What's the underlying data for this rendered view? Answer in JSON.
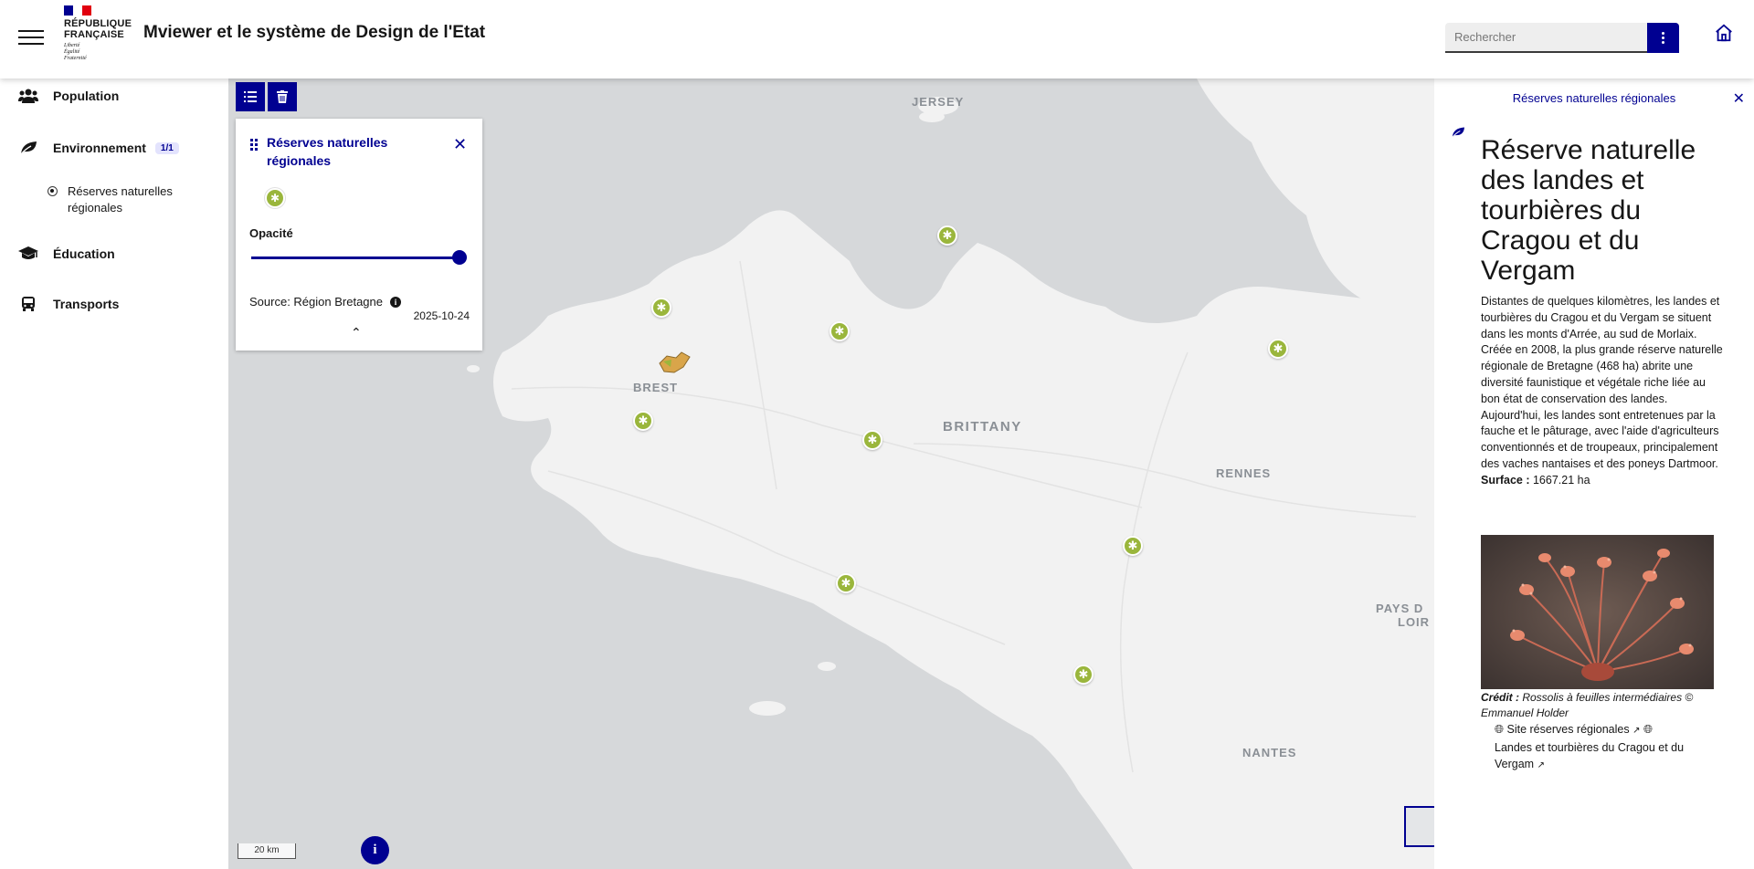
{
  "header": {
    "logo_line1": "RÉPUBLIQUE",
    "logo_line2": "FRANÇAISE",
    "logo_motto": [
      "Liberté",
      "Égalité",
      "Fraternité"
    ],
    "title": "Mviewer et le système de Design de l'Etat",
    "search_placeholder": "Rechercher",
    "menu_icon": "hamburger-icon",
    "home_icon": "home-icon"
  },
  "sidebar": {
    "items": [
      {
        "label": "Population",
        "icon": "people-icon"
      },
      {
        "label": "Environnement",
        "icon": "leaf-icon",
        "badge": "1/1"
      },
      {
        "label": "Éducation",
        "icon": "graduation-cap-icon"
      },
      {
        "label": "Transports",
        "icon": "bus-icon"
      }
    ],
    "sub_item": {
      "label_line1": "Réserves naturelles",
      "label_line2": "régionales"
    }
  },
  "map": {
    "labels": {
      "jersey": "JERSEY",
      "brest": "BREST",
      "brittany": "BRITTANY",
      "rennes": "RENNES",
      "pays_line1": "PAYS D",
      "pays_line2": "LOIR",
      "nantes": "NANTES"
    },
    "scale": "20 km",
    "info_button": "i",
    "marker_color": "#9ab63c"
  },
  "legend": {
    "title": "Réserves naturelles régionales",
    "opacity_label": "Opacité",
    "opacity": 1.0,
    "source": "Source: Région Bretagne",
    "date": "2025-10-24"
  },
  "panel": {
    "header": "Réserves naturelles régionales",
    "title": "Réserve naturelle des landes et tourbières du Cragou et du Vergam",
    "description": "Distantes de quelques kilomètres, les landes et tourbières du Cragou et du Vergam se situent dans les monts d'Arrée, au sud de Morlaix. Créée en 2008, la plus grande réserve naturelle régionale de Bretagne (468 ha) abrite une diversité faunistique et végétale riche liée au bon état de conservation des landes. Aujourd'hui, les landes sont entretenues par la fauche et le pâturage, avec l'aide d'agriculteurs conventionnés et de troupeaux, principalement des vaches nantaises et des poneys Dartmoor.",
    "surface_label": "Surface :",
    "surface_value": "1667.21 ha",
    "credit_label": "Crédit :",
    "credit_text": "Rossolis à feuilles intermédiaires © Emmanuel Holder",
    "link1": "Site réserves régionales",
    "link2": "Landes et tourbières du Cragou et du Vergam"
  },
  "colors": {
    "primary": "#000091",
    "marker": "#9ab63c",
    "sea": "#d6d8da",
    "land": "#f2f2f2"
  }
}
